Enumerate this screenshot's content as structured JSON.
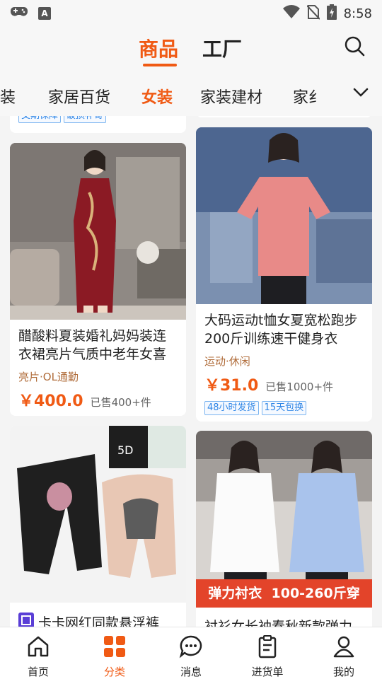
{
  "status_bar": {
    "time": "8:58"
  },
  "header": {
    "tabs": [
      "商品",
      "工厂"
    ]
  },
  "categories": [
    "男装",
    "家居百货",
    "女装",
    "家装建材",
    "家纟"
  ],
  "cards": {
    "top_left": {
      "badges": [
        "交期保障",
        "破损补寄"
      ]
    },
    "dress": {
      "title": "醋酸料夏装婚礼妈妈装连衣裙亮片气质中老年女喜",
      "style": "亮片·OL通勤",
      "price": "￥400.0",
      "sold": "已售400+件"
    },
    "tshirt": {
      "title": "大码运动t恤女夏宽松跑步200斤训练速干健身衣",
      "style": "运动·休闲",
      "price": "￥31.0",
      "sold": "已售1000+件",
      "badges": [
        "48小时发货",
        "15天包换"
      ]
    },
    "shapewear": {
      "title": "卡卡网红同款悬浮裤",
      "pack_label": "5D"
    },
    "shirt": {
      "banner": "弹力衬衣  100-260斤穿",
      "title": "衬衫女长袖春秋新款弹力"
    }
  },
  "bottom_nav": [
    "首页",
    "分类",
    "消息",
    "进货单",
    "我的"
  ],
  "colors": {
    "accent": "#f05a14",
    "badge_blue": "#2f86e6"
  }
}
